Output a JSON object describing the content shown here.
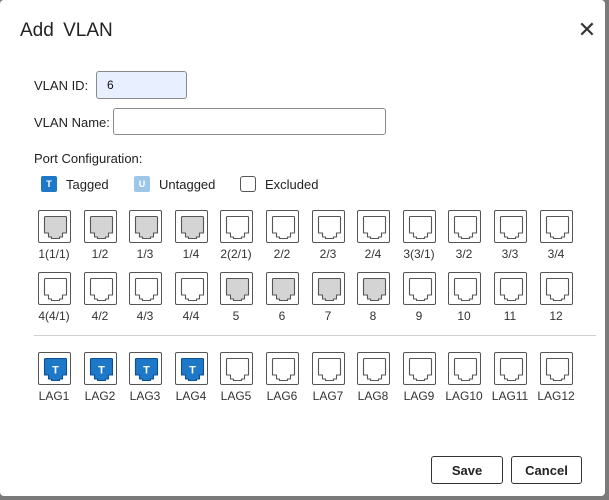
{
  "dialog": {
    "title": "Add  VLAN",
    "close_icon": "close-icon"
  },
  "form": {
    "vlan_id_label": "VLAN  ID:",
    "vlan_id_value": "6",
    "vlan_name_label": "VLAN Name:",
    "vlan_name_value": "",
    "port_config_label": "Port Configuration:"
  },
  "legend": {
    "tagged": {
      "letter": "T",
      "label": "Tagged"
    },
    "untagged": {
      "letter": "U",
      "label": "Untagged"
    },
    "excluded": {
      "label": "Excluded"
    }
  },
  "colors": {
    "tagged": "#1e78c8",
    "untagged": "#9cc7e8",
    "member_gray": "#d4d4d4",
    "excluded": "#ffffff"
  },
  "ports_row1": [
    {
      "label": "1(1/1)",
      "state": "gray"
    },
    {
      "label": "1/2",
      "state": "gray"
    },
    {
      "label": "1/3",
      "state": "gray"
    },
    {
      "label": "1/4",
      "state": "gray"
    },
    {
      "label": "2(2/1)",
      "state": "excluded"
    },
    {
      "label": "2/2",
      "state": "excluded"
    },
    {
      "label": "2/3",
      "state": "excluded"
    },
    {
      "label": "2/4",
      "state": "excluded"
    },
    {
      "label": "3(3/1)",
      "state": "excluded"
    },
    {
      "label": "3/2",
      "state": "excluded"
    },
    {
      "label": "3/3",
      "state": "excluded"
    },
    {
      "label": "3/4",
      "state": "excluded"
    }
  ],
  "ports_row2": [
    {
      "label": "4(4/1)",
      "state": "excluded"
    },
    {
      "label": "4/2",
      "state": "excluded"
    },
    {
      "label": "4/3",
      "state": "excluded"
    },
    {
      "label": "4/4",
      "state": "excluded"
    },
    {
      "label": "5",
      "state": "gray"
    },
    {
      "label": "6",
      "state": "gray"
    },
    {
      "label": "7",
      "state": "gray"
    },
    {
      "label": "8",
      "state": "gray"
    },
    {
      "label": "9",
      "state": "excluded"
    },
    {
      "label": "10",
      "state": "excluded"
    },
    {
      "label": "11",
      "state": "excluded"
    },
    {
      "label": "12",
      "state": "excluded"
    }
  ],
  "lags": [
    {
      "label": "LAG1",
      "state": "tagged",
      "letter": "T"
    },
    {
      "label": "LAG2",
      "state": "tagged",
      "letter": "T"
    },
    {
      "label": "LAG3",
      "state": "tagged",
      "letter": "T"
    },
    {
      "label": "LAG4",
      "state": "tagged",
      "letter": "T"
    },
    {
      "label": "LAG5",
      "state": "excluded"
    },
    {
      "label": "LAG6",
      "state": "excluded"
    },
    {
      "label": "LAG7",
      "state": "excluded"
    },
    {
      "label": "LAG8",
      "state": "excluded"
    },
    {
      "label": "LAG9",
      "state": "excluded"
    },
    {
      "label": "LAG10",
      "state": "excluded"
    },
    {
      "label": "LAG11",
      "state": "excluded"
    },
    {
      "label": "LAG12",
      "state": "excluded"
    }
  ],
  "actions": {
    "save_label": "Save",
    "cancel_label": "Cancel"
  }
}
